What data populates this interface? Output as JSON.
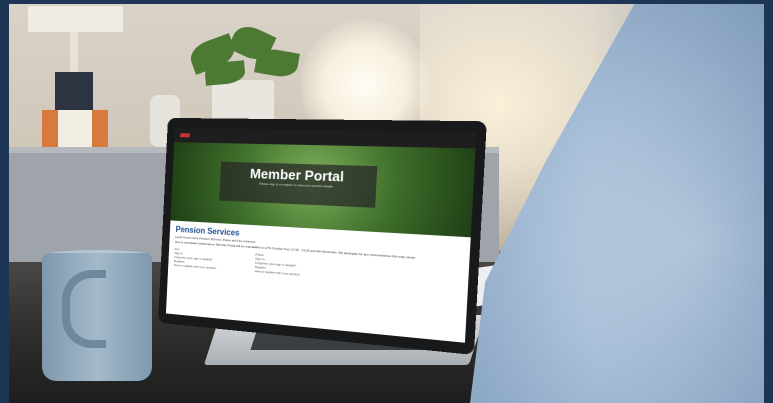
{
  "screen": {
    "hero_title": "Member Portal",
    "hero_subtitle": "Please sign in or register to view your pension details",
    "section_title": "Pension Services",
    "intro_line": "Local Government Pension Scheme, Police and Fire schemes",
    "notice_line": "Due to scheduled maintenance, Member Portal will be unavailable on 27th October from 17:00 - 21:00 and 4th November. We apologise for any inconvenience this may cause.",
    "columns": [
      {
        "heading": "Fire",
        "links": [
          "Sign in",
          "Forgotten your sign in details?",
          "Register",
          "How to register with your pension"
        ]
      },
      {
        "heading": "Police",
        "links": [
          "Sign in",
          "Forgotten your sign in details?",
          "Register",
          "How to register with your pension"
        ]
      }
    ]
  },
  "colors": {
    "frame_border": "#1d3655",
    "section_title": "#1d4e8c",
    "shirt": "#a9c0d8",
    "mug": "#8fa8bd"
  }
}
